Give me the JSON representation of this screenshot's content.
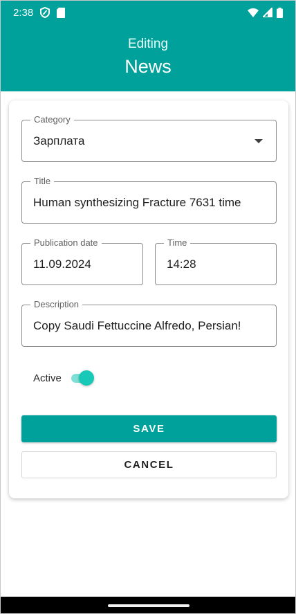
{
  "status_bar": {
    "time": "2:38",
    "icons_left": [
      "shield-icon",
      "sim-card-icon"
    ],
    "icons_right": [
      "wifi-icon",
      "signal-icon",
      "battery-icon"
    ]
  },
  "app_bar": {
    "subtitle": "Editing",
    "title": "News",
    "color": "#00a19a"
  },
  "form": {
    "category": {
      "label": "Category",
      "value": "Зарплата"
    },
    "title": {
      "label": "Title",
      "value": "Human synthesizing Fracture 7631 time"
    },
    "publication_date": {
      "label": "Publication date",
      "value": "11.09.2024"
    },
    "time": {
      "label": "Time",
      "value": "14:28"
    },
    "description": {
      "label": "Description",
      "value": "Copy Saudi Fettuccine Alfredo, Persian!"
    },
    "active": {
      "label": "Active",
      "checked": true
    }
  },
  "actions": {
    "save_label": "SAVE",
    "cancel_label": "CANCEL"
  },
  "colors": {
    "accent": "#00a19a",
    "switch_thumb": "#17c9b6",
    "switch_track": "#7fe0d6"
  }
}
